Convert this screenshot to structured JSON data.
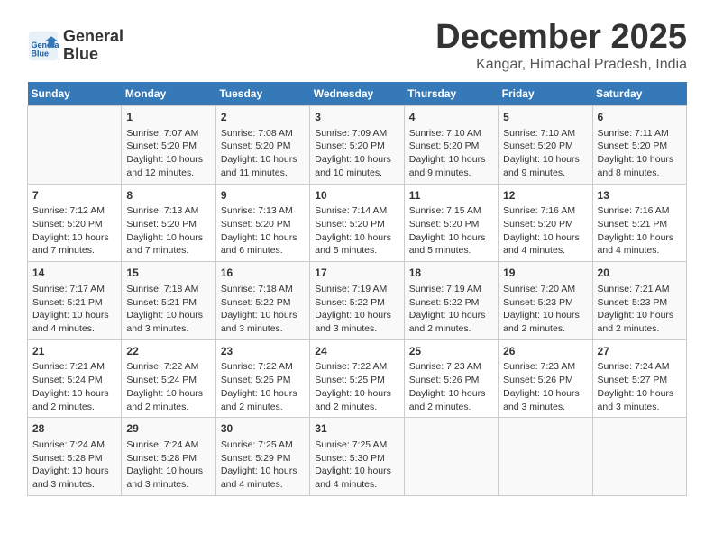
{
  "logo": {
    "name_line1": "General",
    "name_line2": "Blue"
  },
  "header": {
    "month_year": "December 2025",
    "location": "Kangar, Himachal Pradesh, India"
  },
  "weekdays": [
    "Sunday",
    "Monday",
    "Tuesday",
    "Wednesday",
    "Thursday",
    "Friday",
    "Saturday"
  ],
  "weeks": [
    [
      {
        "day": "",
        "info": ""
      },
      {
        "day": "1",
        "info": "Sunrise: 7:07 AM\nSunset: 5:20 PM\nDaylight: 10 hours\nand 12 minutes."
      },
      {
        "day": "2",
        "info": "Sunrise: 7:08 AM\nSunset: 5:20 PM\nDaylight: 10 hours\nand 11 minutes."
      },
      {
        "day": "3",
        "info": "Sunrise: 7:09 AM\nSunset: 5:20 PM\nDaylight: 10 hours\nand 10 minutes."
      },
      {
        "day": "4",
        "info": "Sunrise: 7:10 AM\nSunset: 5:20 PM\nDaylight: 10 hours\nand 9 minutes."
      },
      {
        "day": "5",
        "info": "Sunrise: 7:10 AM\nSunset: 5:20 PM\nDaylight: 10 hours\nand 9 minutes."
      },
      {
        "day": "6",
        "info": "Sunrise: 7:11 AM\nSunset: 5:20 PM\nDaylight: 10 hours\nand 8 minutes."
      }
    ],
    [
      {
        "day": "7",
        "info": "Sunrise: 7:12 AM\nSunset: 5:20 PM\nDaylight: 10 hours\nand 7 minutes."
      },
      {
        "day": "8",
        "info": "Sunrise: 7:13 AM\nSunset: 5:20 PM\nDaylight: 10 hours\nand 7 minutes."
      },
      {
        "day": "9",
        "info": "Sunrise: 7:13 AM\nSunset: 5:20 PM\nDaylight: 10 hours\nand 6 minutes."
      },
      {
        "day": "10",
        "info": "Sunrise: 7:14 AM\nSunset: 5:20 PM\nDaylight: 10 hours\nand 5 minutes."
      },
      {
        "day": "11",
        "info": "Sunrise: 7:15 AM\nSunset: 5:20 PM\nDaylight: 10 hours\nand 5 minutes."
      },
      {
        "day": "12",
        "info": "Sunrise: 7:16 AM\nSunset: 5:20 PM\nDaylight: 10 hours\nand 4 minutes."
      },
      {
        "day": "13",
        "info": "Sunrise: 7:16 AM\nSunset: 5:21 PM\nDaylight: 10 hours\nand 4 minutes."
      }
    ],
    [
      {
        "day": "14",
        "info": "Sunrise: 7:17 AM\nSunset: 5:21 PM\nDaylight: 10 hours\nand 4 minutes."
      },
      {
        "day": "15",
        "info": "Sunrise: 7:18 AM\nSunset: 5:21 PM\nDaylight: 10 hours\nand 3 minutes."
      },
      {
        "day": "16",
        "info": "Sunrise: 7:18 AM\nSunset: 5:22 PM\nDaylight: 10 hours\nand 3 minutes."
      },
      {
        "day": "17",
        "info": "Sunrise: 7:19 AM\nSunset: 5:22 PM\nDaylight: 10 hours\nand 3 minutes."
      },
      {
        "day": "18",
        "info": "Sunrise: 7:19 AM\nSunset: 5:22 PM\nDaylight: 10 hours\nand 2 minutes."
      },
      {
        "day": "19",
        "info": "Sunrise: 7:20 AM\nSunset: 5:23 PM\nDaylight: 10 hours\nand 2 minutes."
      },
      {
        "day": "20",
        "info": "Sunrise: 7:21 AM\nSunset: 5:23 PM\nDaylight: 10 hours\nand 2 minutes."
      }
    ],
    [
      {
        "day": "21",
        "info": "Sunrise: 7:21 AM\nSunset: 5:24 PM\nDaylight: 10 hours\nand 2 minutes."
      },
      {
        "day": "22",
        "info": "Sunrise: 7:22 AM\nSunset: 5:24 PM\nDaylight: 10 hours\nand 2 minutes."
      },
      {
        "day": "23",
        "info": "Sunrise: 7:22 AM\nSunset: 5:25 PM\nDaylight: 10 hours\nand 2 minutes."
      },
      {
        "day": "24",
        "info": "Sunrise: 7:22 AM\nSunset: 5:25 PM\nDaylight: 10 hours\nand 2 minutes."
      },
      {
        "day": "25",
        "info": "Sunrise: 7:23 AM\nSunset: 5:26 PM\nDaylight: 10 hours\nand 2 minutes."
      },
      {
        "day": "26",
        "info": "Sunrise: 7:23 AM\nSunset: 5:26 PM\nDaylight: 10 hours\nand 3 minutes."
      },
      {
        "day": "27",
        "info": "Sunrise: 7:24 AM\nSunset: 5:27 PM\nDaylight: 10 hours\nand 3 minutes."
      }
    ],
    [
      {
        "day": "28",
        "info": "Sunrise: 7:24 AM\nSunset: 5:28 PM\nDaylight: 10 hours\nand 3 minutes."
      },
      {
        "day": "29",
        "info": "Sunrise: 7:24 AM\nSunset: 5:28 PM\nDaylight: 10 hours\nand 3 minutes."
      },
      {
        "day": "30",
        "info": "Sunrise: 7:25 AM\nSunset: 5:29 PM\nDaylight: 10 hours\nand 4 minutes."
      },
      {
        "day": "31",
        "info": "Sunrise: 7:25 AM\nSunset: 5:30 PM\nDaylight: 10 hours\nand 4 minutes."
      },
      {
        "day": "",
        "info": ""
      },
      {
        "day": "",
        "info": ""
      },
      {
        "day": "",
        "info": ""
      }
    ]
  ]
}
